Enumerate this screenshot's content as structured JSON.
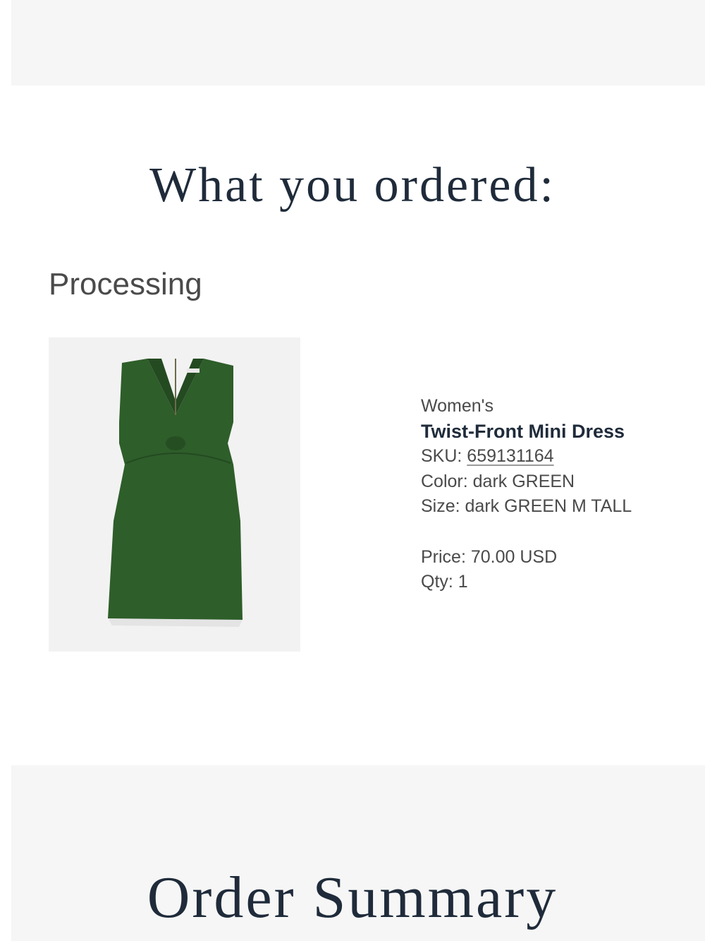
{
  "ordered_section": {
    "title": "What you ordered:",
    "status": "Processing"
  },
  "item": {
    "image_icon": "green-dress-image",
    "category": "Women's",
    "name": "Twist-Front Mini Dress",
    "sku_label": "SKU: ",
    "sku_value": "659131164",
    "color": "Color: dark GREEN",
    "size": "Size: dark GREEN M TALL",
    "price": "Price: 70.00 USD",
    "qty": "Qty: 1",
    "dress_color": "#2e5e2a"
  },
  "summary_section": {
    "title": "Order Summary"
  }
}
